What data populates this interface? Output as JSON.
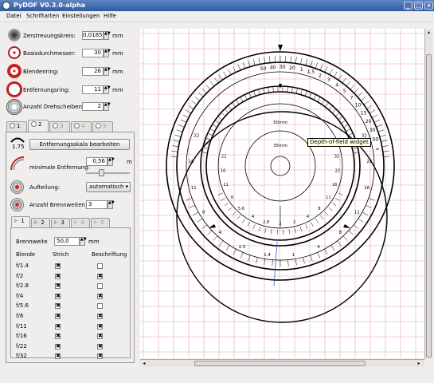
{
  "window": {
    "title": "PyDOF V0.3.0-alpha"
  },
  "menu": [
    "Datei",
    "Schriftarten",
    "Einstellungen",
    "Hilfe"
  ],
  "params": {
    "zerstreuungskreis": {
      "label": "Zerstreuungskreis:",
      "value": "0,0185",
      "unit": "mm"
    },
    "basisdurchmesser": {
      "label": "Basisdurchmesser:",
      "value": "30",
      "unit": "mm"
    },
    "blendenring": {
      "label": "Blendenring:",
      "value": "26",
      "unit": "mm"
    },
    "entfernungsring": {
      "label": "Entfernungsring:",
      "value": "11",
      "unit": "mm"
    },
    "drehscheiben": {
      "label": "Anzahl Drehscheiben:",
      "value": "2"
    }
  },
  "disk_tabs": [
    "1",
    "2",
    "3",
    "4",
    "5"
  ],
  "disk_panel": {
    "scale_value": "1.75",
    "edit_button": "Entfernungsskala bearbeiten",
    "min_distance": {
      "label": "minimale Entfernung:",
      "value": "0,56",
      "unit": "m"
    },
    "aufteilung": {
      "label": "Aufteilung:",
      "value": "automatisch"
    },
    "brennweiten": {
      "label": "Anzahl Brennweiten:",
      "value": "3"
    }
  },
  "focal_tabs": [
    "1",
    "2",
    "3",
    "4",
    "5"
  ],
  "focal_panel": {
    "brennweite_label": "Brennweite",
    "brennweite_value": "50,0",
    "unit": "mm",
    "headers": {
      "blende": "Blende",
      "strich": "Strich",
      "beschriftung": "Beschriftung"
    },
    "rows": [
      {
        "f": "f/1.4",
        "strich": "x",
        "beschr": ""
      },
      {
        "f": "f/2",
        "strich": "x",
        "beschr": "x"
      },
      {
        "f": "f/2.8",
        "strich": "x",
        "beschr": ""
      },
      {
        "f": "f/4",
        "strich": "x",
        "beschr": "x"
      },
      {
        "f": "f/5.6",
        "strich": "x",
        "beschr": ""
      },
      {
        "f": "f/8",
        "strich": "x",
        "beschr": "x"
      },
      {
        "f": "f/11",
        "strich": "x",
        "beschr": "x"
      },
      {
        "f": "f/16",
        "strich": "x",
        "beschr": "x"
      },
      {
        "f": "f/22",
        "strich": "x",
        "beschr": "x"
      },
      {
        "f": "f/32",
        "strich": "x",
        "beschr": "x"
      }
    ]
  },
  "canvas": {
    "tooltip": "Depth-of-field widget",
    "outer_ring_labels": [
      "50",
      "40",
      "30",
      "20",
      "1",
      "1.5",
      "2",
      "3",
      "4",
      "5",
      "7",
      "10",
      "15",
      "20",
      "30",
      "50",
      "∞"
    ],
    "outer_scale_numbers": [
      "22",
      "16",
      "11",
      "8",
      "4",
      "2.5",
      "1.4",
      "1",
      "4",
      "8",
      "11",
      "16",
      "22",
      "32"
    ],
    "inner_ring_labels": [
      "50mm",
      "35mm"
    ],
    "inner_scale_numbers": [
      "22",
      "16",
      "11",
      "8",
      "5.6",
      "4",
      "2.8",
      "2",
      "2",
      "4",
      "8",
      "11",
      "16",
      "22",
      "32"
    ]
  }
}
